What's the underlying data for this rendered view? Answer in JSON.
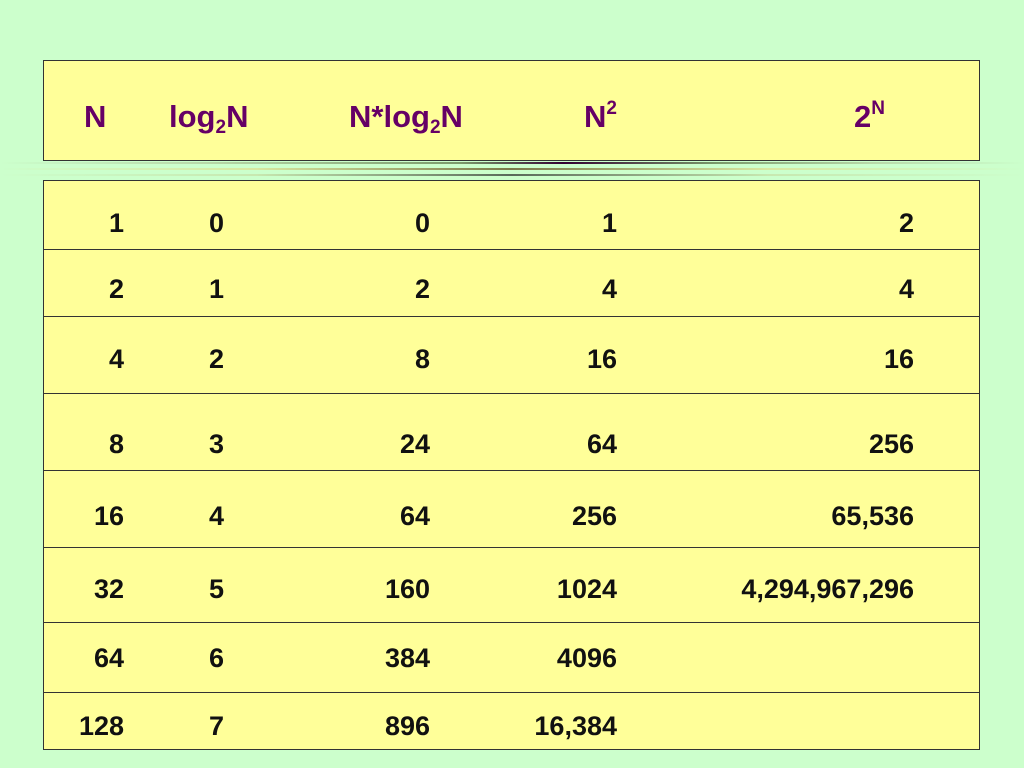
{
  "header": {
    "n": "N",
    "log_base": "log",
    "log_sub": "2",
    "log_suffix": "N",
    "nlog_prefix": "N*log",
    "nlog_sub": "2",
    "nlog_suffix": "N",
    "nsq_base": "N",
    "nsq_sup": "2",
    "exp_base": "2",
    "exp_sup": "N"
  },
  "rows": [
    [
      "1",
      "0",
      "0",
      "1",
      "2"
    ],
    [
      "2",
      "1",
      "2",
      "4",
      "4"
    ],
    [
      "4",
      "2",
      "8",
      "16",
      "16"
    ],
    [
      "8",
      "3",
      "24",
      "64",
      "256"
    ],
    [
      "16",
      "4",
      "64",
      "256",
      "65,536"
    ],
    [
      "32",
      "5",
      "160",
      "1024",
      "4,294,967,296"
    ],
    [
      "64",
      "6",
      "384",
      "4096",
      ""
    ],
    [
      "128",
      "7",
      "896",
      "16,384",
      ""
    ]
  ],
  "colors": {
    "background": "#ccffcc",
    "panel": "#ffff99",
    "header_text": "#660066",
    "rule_dark": "#330033"
  }
}
